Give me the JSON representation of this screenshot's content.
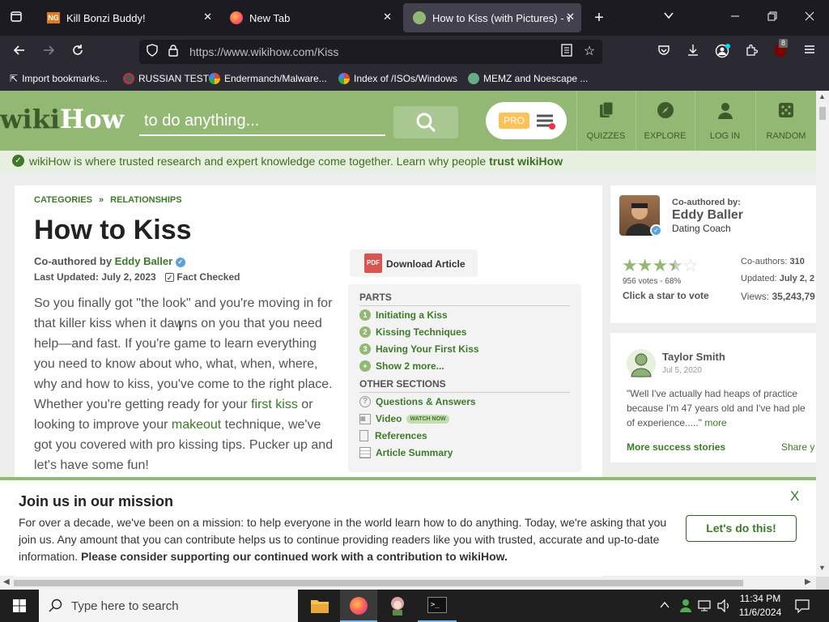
{
  "browser": {
    "tabs": [
      {
        "label": "Kill Bonzi Buddy!",
        "active": false
      },
      {
        "label": "New Tab",
        "active": false
      },
      {
        "label": "How to Kiss (with Pictures) - wi",
        "active": true
      }
    ],
    "url": "https://www.wikihow.com/Kiss",
    "bookmarks": [
      "Import bookmarks...",
      "RUSSIAN TEST",
      "Endermanch/Malware...",
      "Index of /ISOs/Windows",
      "MEMZ and Noescape ..."
    ],
    "extension_badge": "8"
  },
  "header": {
    "logo_wiki": "wiki",
    "logo_how": "How",
    "search_placeholder": "to do anything...",
    "pro_label": "PRO",
    "nav": [
      "QUIZZES",
      "EXPLORE",
      "LOG IN",
      "RANDOM"
    ]
  },
  "trustbar": {
    "text": "wikiHow is where trusted research and expert knowledge come together. Learn why people ",
    "link": "trust wikiHow"
  },
  "article": {
    "breadcrumb_1": "CATEGORIES",
    "breadcrumb_sep": "»",
    "breadcrumb_2": "RELATIONSHIPS",
    "title": "How to Kiss",
    "coauthored_prefix": "Co-authored by ",
    "coauthor": "Eddy Baller",
    "updated": "Last Updated: July 2, 2023",
    "fact_checked": "Fact Checked",
    "download": "Download Article",
    "intro": [
      {
        "t": "So you finally got \"the look\" and you're moving in for that killer kiss when it dawns on you that you need help—and fast. If you're game to learn everything you need to know about who, what, when, where, why and how to kiss, you've come to the right place. Whether you're getting ready for your "
      },
      {
        "link": "first kiss"
      },
      {
        "t": " or looking to improve your "
      },
      {
        "link": "makeout"
      },
      {
        "t": " technique, we've got you covered with pro kissing tips. Pucker up and let's have some fun!"
      }
    ]
  },
  "toc": {
    "parts_heading": "PARTS",
    "parts": [
      {
        "num": "1",
        "label": "Initiating a Kiss"
      },
      {
        "num": "2",
        "label": "Kissing Techniques"
      },
      {
        "num": "3",
        "label": "Having Your First Kiss"
      },
      {
        "num": "+",
        "label": "Show 2 more..."
      }
    ],
    "other_heading": "OTHER SECTIONS",
    "other": [
      {
        "icon": "question-icon",
        "label": "Questions & Answers"
      },
      {
        "icon": "video-icon",
        "label": "Video",
        "badge": "WATCH NOW"
      },
      {
        "icon": "references-icon",
        "label": "References"
      },
      {
        "icon": "summary-icon",
        "label": "Article Summary"
      }
    ]
  },
  "author_card": {
    "heading": "Co-authored by:",
    "name": "Eddy Baller",
    "role": "Dating Coach",
    "rating": 3.5,
    "votes": "956 votes - 68%",
    "click_vote": "Click a star to vote",
    "coauthors_label": "Co-authors: ",
    "coauthors_value": "310",
    "updated_label": "Updated: ",
    "updated_value": "July 2, 2",
    "views_label": "Views: ",
    "views_value": "35,243,79"
  },
  "testimonial": {
    "name": "Taylor Smith",
    "date": "Jul 5, 2020",
    "quote": "\"Well I've actually had heaps of practice because I'm 47 years old and I've had ple of experience.....\"",
    "more": "more",
    "more_stories": "More success stories",
    "share": "Share y"
  },
  "banner": {
    "title": "Join us in our mission",
    "close": "X",
    "body": "For over a decade, we've been on a mission: to help everyone in the world learn how to do anything. Today, we're asking that you join us. Any amount that you can contribute helps us to continue providing readers like you with trusted, accurate and up-to-date information. ",
    "body_bold": "Please consider supporting our continued work with a contribution to wikiHow.",
    "button": "Let's do this!"
  },
  "taskbar": {
    "search_placeholder": "Type here to search",
    "time": "11:34 PM",
    "date": "11/6/2024"
  },
  "colors": {
    "wikihow_green": "#93b874",
    "link_green": "#3c7a2a",
    "firefox_dark": "#1c1b22",
    "taskbar": "#1f1f1f"
  }
}
